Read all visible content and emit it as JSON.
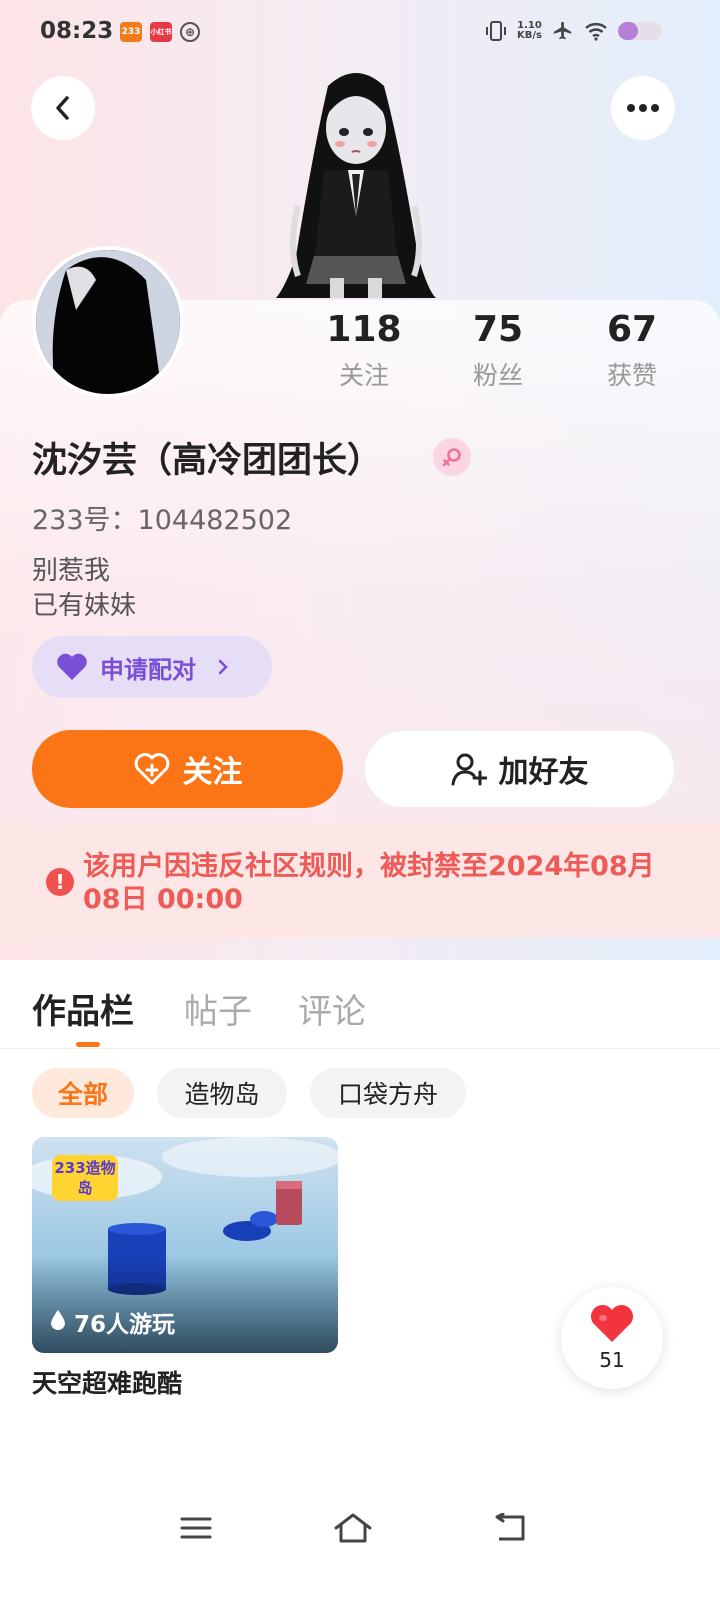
{
  "status_bar": {
    "time": "08:23",
    "app_icons": [
      "233",
      "小红书",
      "⊕"
    ],
    "net_speed_value": "1.10",
    "net_speed_unit": "KB/s",
    "battery_level": 0.45,
    "battery_color": "#b57fd8"
  },
  "header": {
    "back_icon": "chevron-left-icon",
    "more_icon": "more-dots-icon"
  },
  "profile": {
    "name": "沈汐芸（高冷团团长）",
    "gender": "female",
    "id_line": "233号：104482502",
    "bio_lines": [
      "别惹我",
      "已有妹妹"
    ]
  },
  "stats": [
    {
      "value": "118",
      "label": "关注"
    },
    {
      "value": "75",
      "label": "粉丝"
    },
    {
      "value": "67",
      "label": "获赞"
    }
  ],
  "pair_button": {
    "label": "申请配对"
  },
  "actions": {
    "follow_label": "关注",
    "add_friend_label": "加好友",
    "accent_color": "#fb7416"
  },
  "ban_notice": {
    "text": "该用户因违反社区规则，被封禁至2024年08月08日 00:00"
  },
  "tabs": [
    {
      "label": "作品栏",
      "active": true
    },
    {
      "label": "帖子",
      "active": false
    },
    {
      "label": "评论",
      "active": false
    }
  ],
  "filters": [
    {
      "label": "全部",
      "active": true
    },
    {
      "label": "造物岛",
      "active": false
    },
    {
      "label": "口袋方舟",
      "active": false
    }
  ],
  "works": [
    {
      "thumb_logo": "233造物岛",
      "plays": "76人游玩",
      "title": "天空超难跑酷"
    }
  ],
  "like_float": {
    "count": "51"
  },
  "nav": {
    "menu_icon": "menu-icon",
    "home_icon": "home-icon",
    "back_icon": "back-icon"
  }
}
